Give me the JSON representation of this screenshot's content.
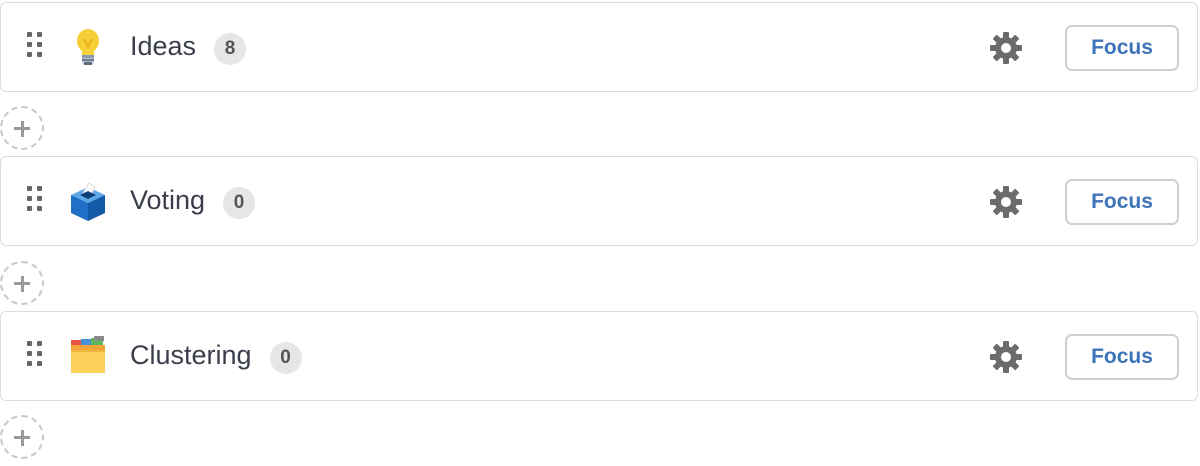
{
  "stages": [
    {
      "name": "Ideas",
      "count": "8",
      "icon": "lightbulb-icon",
      "action_label": "Focus"
    },
    {
      "name": "Voting",
      "count": "0",
      "icon": "ballot-box-icon",
      "action_label": "Focus"
    },
    {
      "name": "Clustering",
      "count": "0",
      "icon": "card-index-dividers-icon",
      "action_label": "Focus"
    }
  ],
  "colors": {
    "accent": "#3d73b8",
    "badge_bg": "#e6e6e6",
    "border": "#dcdcdc"
  }
}
